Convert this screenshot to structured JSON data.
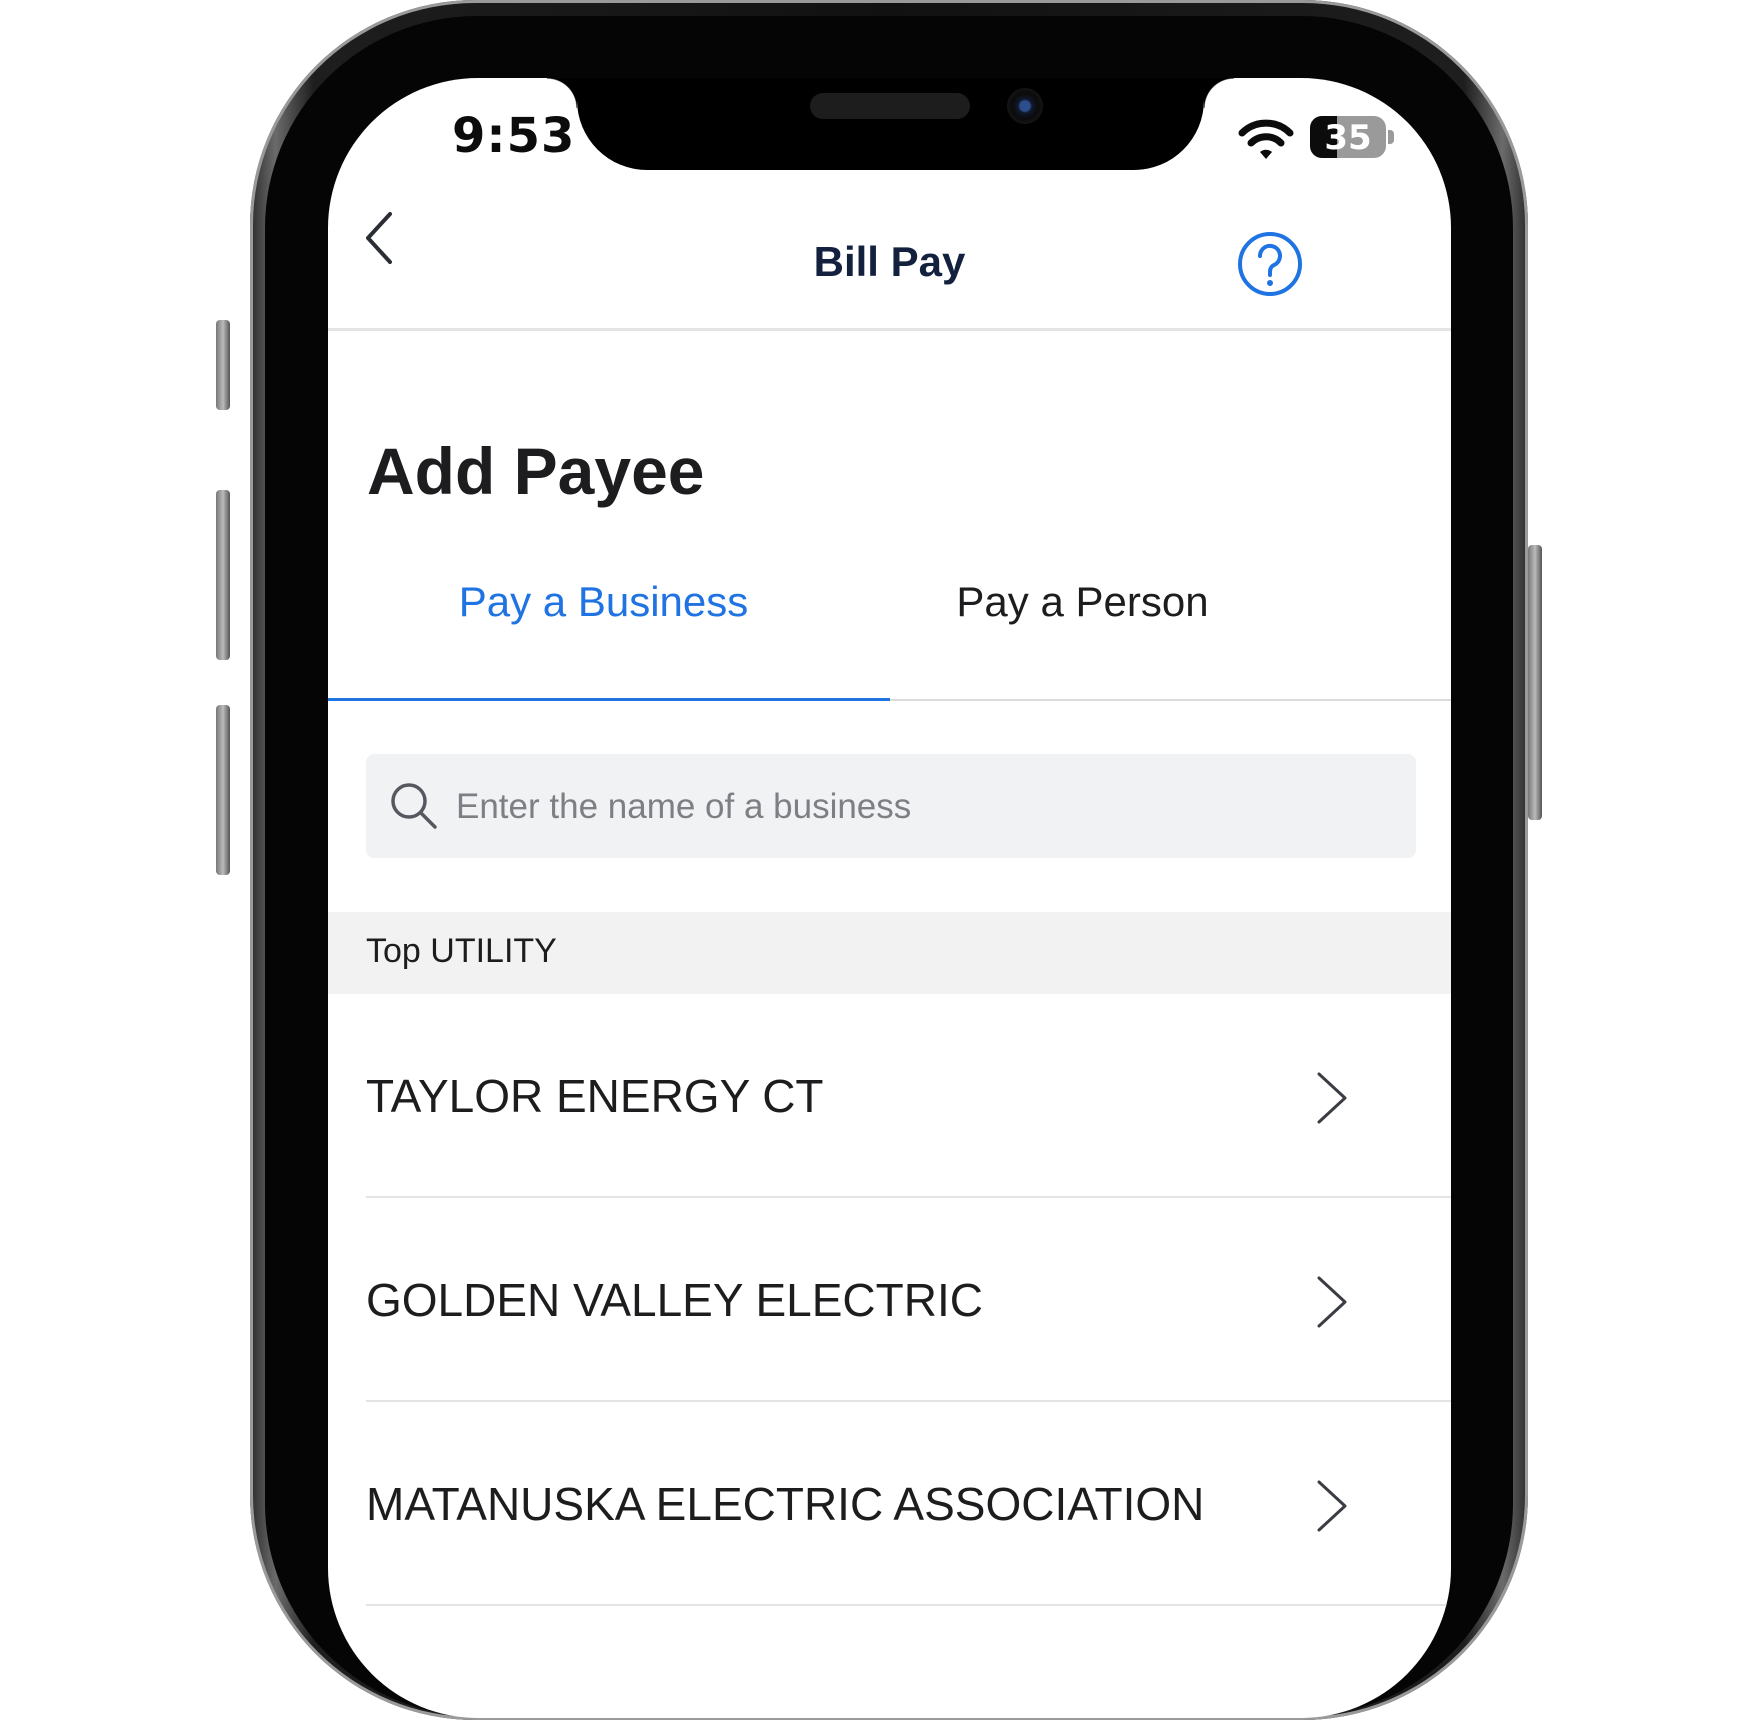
{
  "status_bar": {
    "time": "9:53",
    "battery_level": "35",
    "battery_fraction": 0.35
  },
  "nav": {
    "title": "Bill Pay",
    "back_icon": "chevron-left-icon",
    "help_icon": "question-circle-icon"
  },
  "page": {
    "title": "Add Payee"
  },
  "tabs": [
    {
      "label": "Pay a Business",
      "active": true
    },
    {
      "label": "Pay a Person",
      "active": false
    }
  ],
  "search": {
    "placeholder": "Enter the name of a business",
    "value": ""
  },
  "section": {
    "label": "Top UTILITY"
  },
  "payees": [
    {
      "name": "TAYLOR ENERGY CT"
    },
    {
      "name": "GOLDEN VALLEY ELECTRIC"
    },
    {
      "name": "MATANUSKA ELECTRIC ASSOCIATION"
    }
  ],
  "colors": {
    "accent": "#1f73e2",
    "title_navy": "#13213f",
    "text": "#1d1d1f",
    "section_bg": "#f2f2f2",
    "search_bg": "#f1f2f4"
  }
}
